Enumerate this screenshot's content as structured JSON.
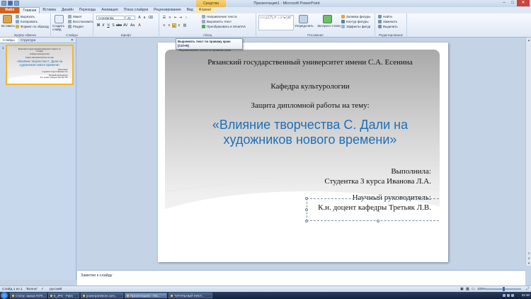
{
  "window": {
    "title": "Презентация1 - Microsoft PowerPoint",
    "context_tab": "Средства рисования"
  },
  "ribbon_tabs": [
    {
      "label": "Файл"
    },
    {
      "label": "Главная"
    },
    {
      "label": "Вставка"
    },
    {
      "label": "Дизайн"
    },
    {
      "label": "Переходы"
    },
    {
      "label": "Анимация"
    },
    {
      "label": "Показ слайдов"
    },
    {
      "label": "Рецензирование"
    },
    {
      "label": "Вид"
    },
    {
      "label": "Формат"
    }
  ],
  "ribbon": {
    "clipboard": {
      "paste": "Вставить",
      "cut": "Вырезать",
      "copy": "Копировать",
      "format_painter": "Формат по образцу",
      "label": "Буфер обмена"
    },
    "slides": {
      "new_slide": "Создать слайд",
      "layout": "Макет",
      "reset": "Восстановить",
      "section": "Раздел",
      "label": "Слайды"
    },
    "font": {
      "name": "Constantia",
      "size": "21",
      "label": "Шрифт"
    },
    "paragraph": {
      "label": "Абзац",
      "direction": "Направление текста",
      "align_text": "Выровнять текст",
      "smartart": "Преобразовать в SmartArt"
    },
    "drawing": {
      "arrange": "Упорядочить",
      "quick_styles": "Экспресс-стили",
      "fill": "Заливка фигуры",
      "outline": "Контур фигуры",
      "effects": "Эффекты фигур",
      "label": "Рисование"
    },
    "editing": {
      "find": "Найти",
      "replace": "Заменить",
      "select": "Выделить",
      "label": "Редактирование"
    }
  },
  "tooltip": {
    "title": "Выровнять текст по правому краю (Ctrl+R)",
    "body": "Выравнивание текста по правому краю."
  },
  "left_pane": {
    "tabs": [
      "Слайды",
      "Структура"
    ],
    "slide_number": "1"
  },
  "slide": {
    "university": "Рязанский государственный университет имени С.А. Есенина",
    "department": "Кафедра культурологии",
    "defense": "Защита дипломной работы на тему:",
    "title": "«Влияние творчества С. Дали на художников нового времени»",
    "author_label": "Выполнила:",
    "author": "Студентка 3 курса Иванова Л.А.",
    "advisor_label": "Научный руководитель:",
    "advisor": "К.н. доцент кафедры Третьяк Л.В."
  },
  "notes": {
    "placeholder": "Заметки к слайду"
  },
  "statusbar": {
    "slide_info": "Слайд 1 из 1",
    "theme": "\"Волна\"",
    "language": "русский",
    "zoom": "105%"
  },
  "taskbar": {
    "tasks": [
      "Статус заказа #376...",
      "8_JPG - Paint",
      "powerpointstore.com...",
      "Презентация1 - Mic...",
      "ТИТУЛЬНЫЙ ЛИСТ..."
    ],
    "clock": "22:30"
  }
}
